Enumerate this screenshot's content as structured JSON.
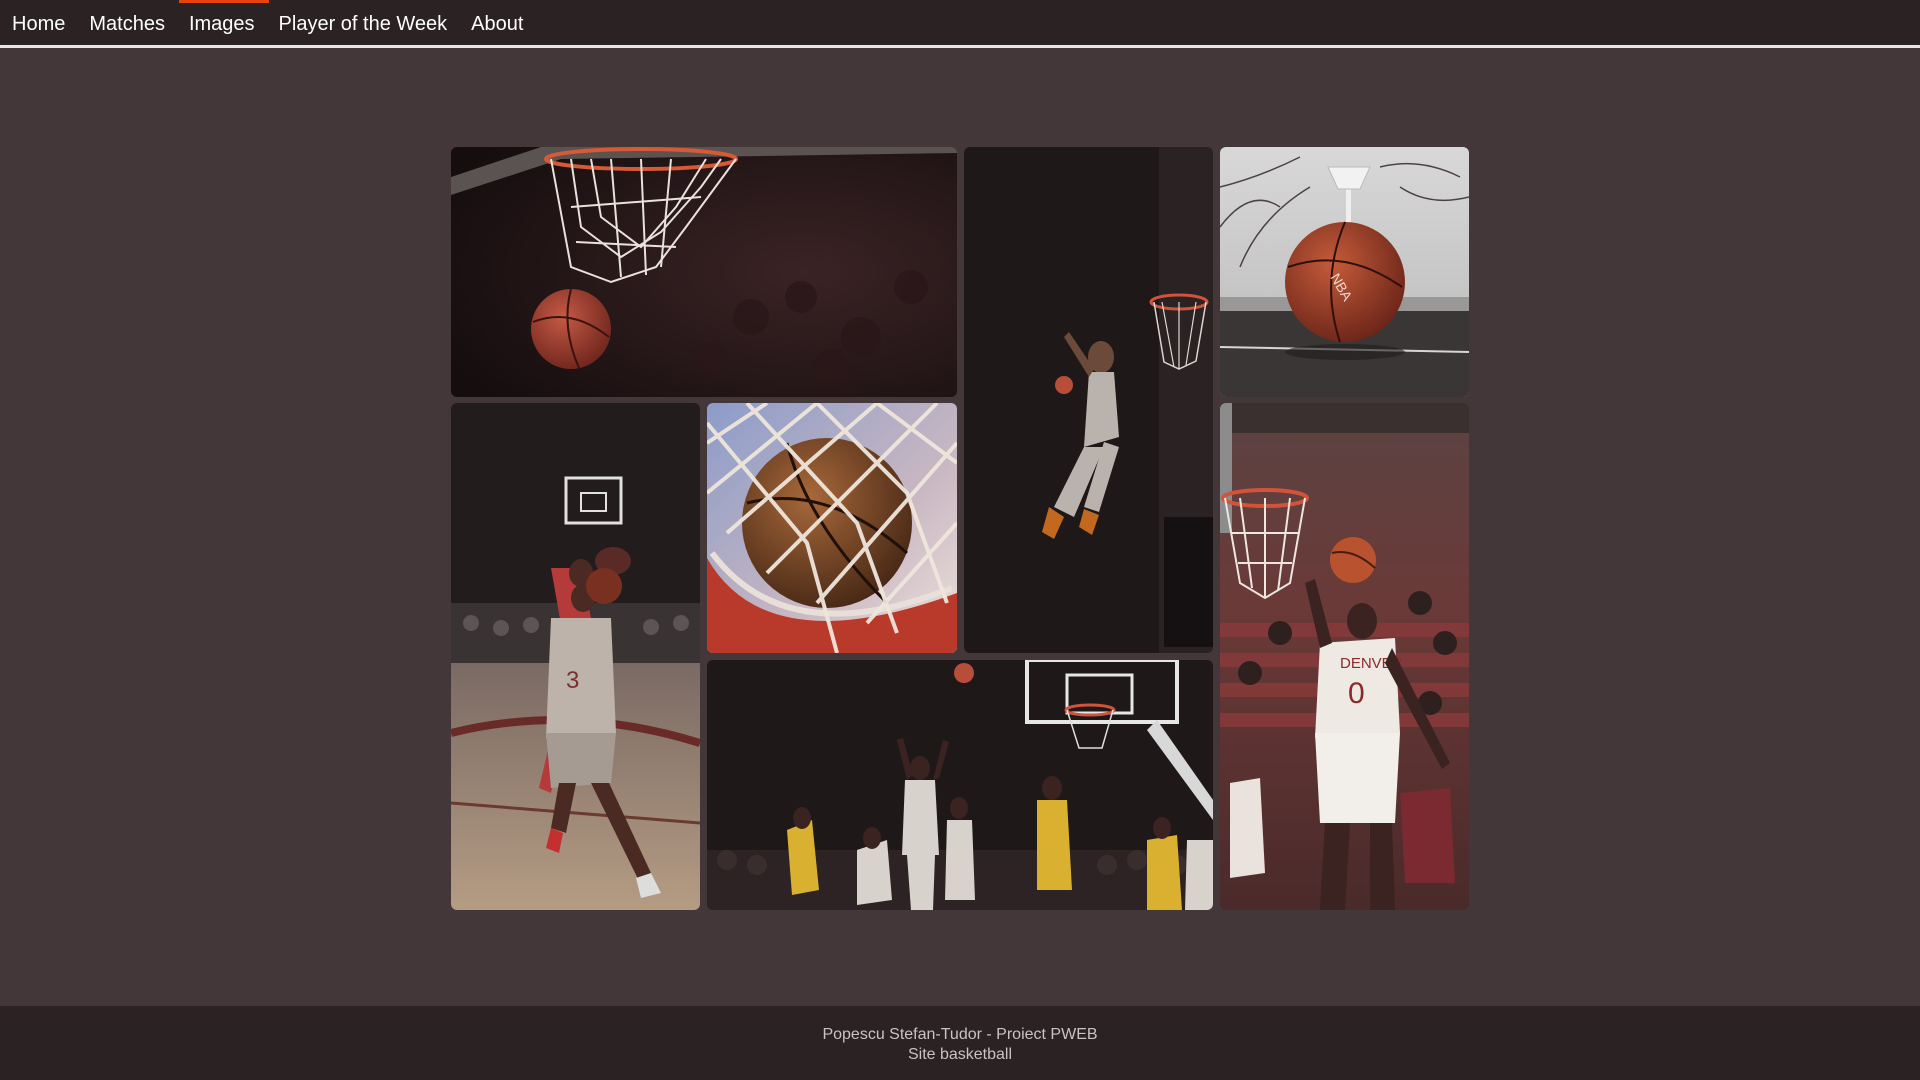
{
  "nav": {
    "items": [
      "Home",
      "Matches",
      "Images",
      "Player of the Week",
      "About"
    ],
    "active_item": "Images",
    "accent_color": "#e8430f"
  },
  "gallery": {
    "images": [
      "basketball-rim-ball-photo",
      "player-dunk-dark-photo",
      "spalding-nba-ball-court-photo",
      "pioneers-player-3-drive-photo",
      "ball-in-net-closeup-photo",
      "free-throw-game-photo",
      "denver-player-0-dunk-photo"
    ]
  },
  "footer": {
    "line1": "Popescu Stefan-Tudor - Proiect PWEB",
    "line2": "Site basketball"
  },
  "colors": {
    "background": "#433739",
    "bars": "#2a2223"
  }
}
